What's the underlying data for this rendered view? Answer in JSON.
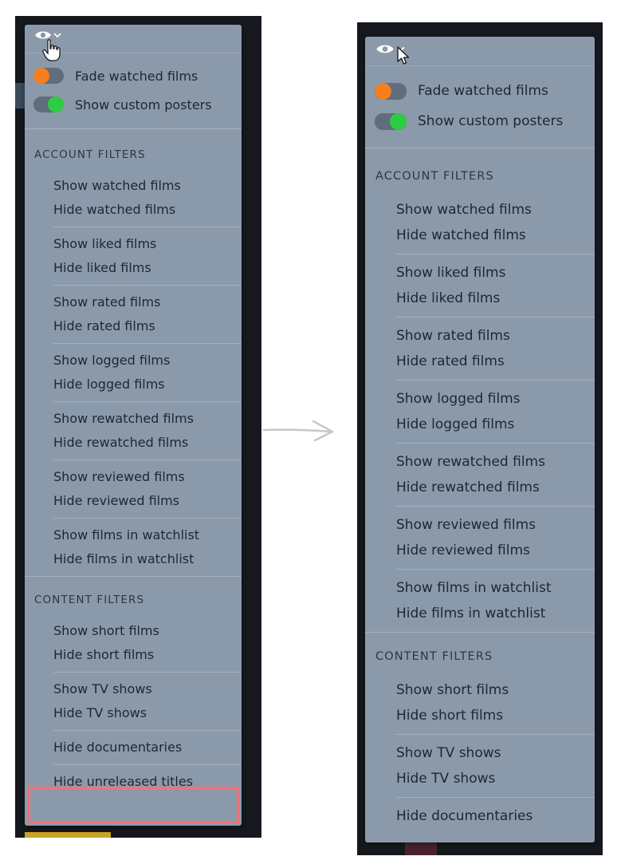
{
  "menu": {
    "toggles": [
      {
        "label": "Fade watched films",
        "state": "off",
        "knob_color": "#f57f1f"
      },
      {
        "label": "Show custom posters",
        "state": "on",
        "knob_color": "#2ecc40"
      }
    ],
    "account_filters_title": "ACCOUNT FILTERS",
    "account_groups": [
      [
        "Show watched films",
        "Hide watched films"
      ],
      [
        "Show liked films",
        "Hide liked films"
      ],
      [
        "Show rated films",
        "Hide rated films"
      ],
      [
        "Show logged films",
        "Hide logged films"
      ],
      [
        "Show rewatched films",
        "Hide rewatched films"
      ],
      [
        "Show reviewed films",
        "Hide reviewed films"
      ],
      [
        "Show films in watchlist",
        "Hide films in watchlist"
      ]
    ],
    "content_filters_title": "CONTENT FILTERS",
    "content_groups": [
      [
        "Show short films",
        "Hide short films"
      ],
      [
        "Show TV shows",
        "Hide TV shows"
      ],
      [
        "Hide documentaries"
      ]
    ],
    "extra_option": "Hide unreleased titles"
  },
  "colors": {
    "menu_bg": "#8b9aab",
    "highlight": "#f0727a",
    "toggle_off": "#f57f1f",
    "toggle_on": "#2ecc40"
  },
  "icons": {
    "eye": "eye-icon",
    "chevron": "chevron-down-icon",
    "cursor_left": "hand-pointer-icon",
    "cursor_right": "arrow-pointer-icon",
    "transition": "right-arrow-icon"
  }
}
